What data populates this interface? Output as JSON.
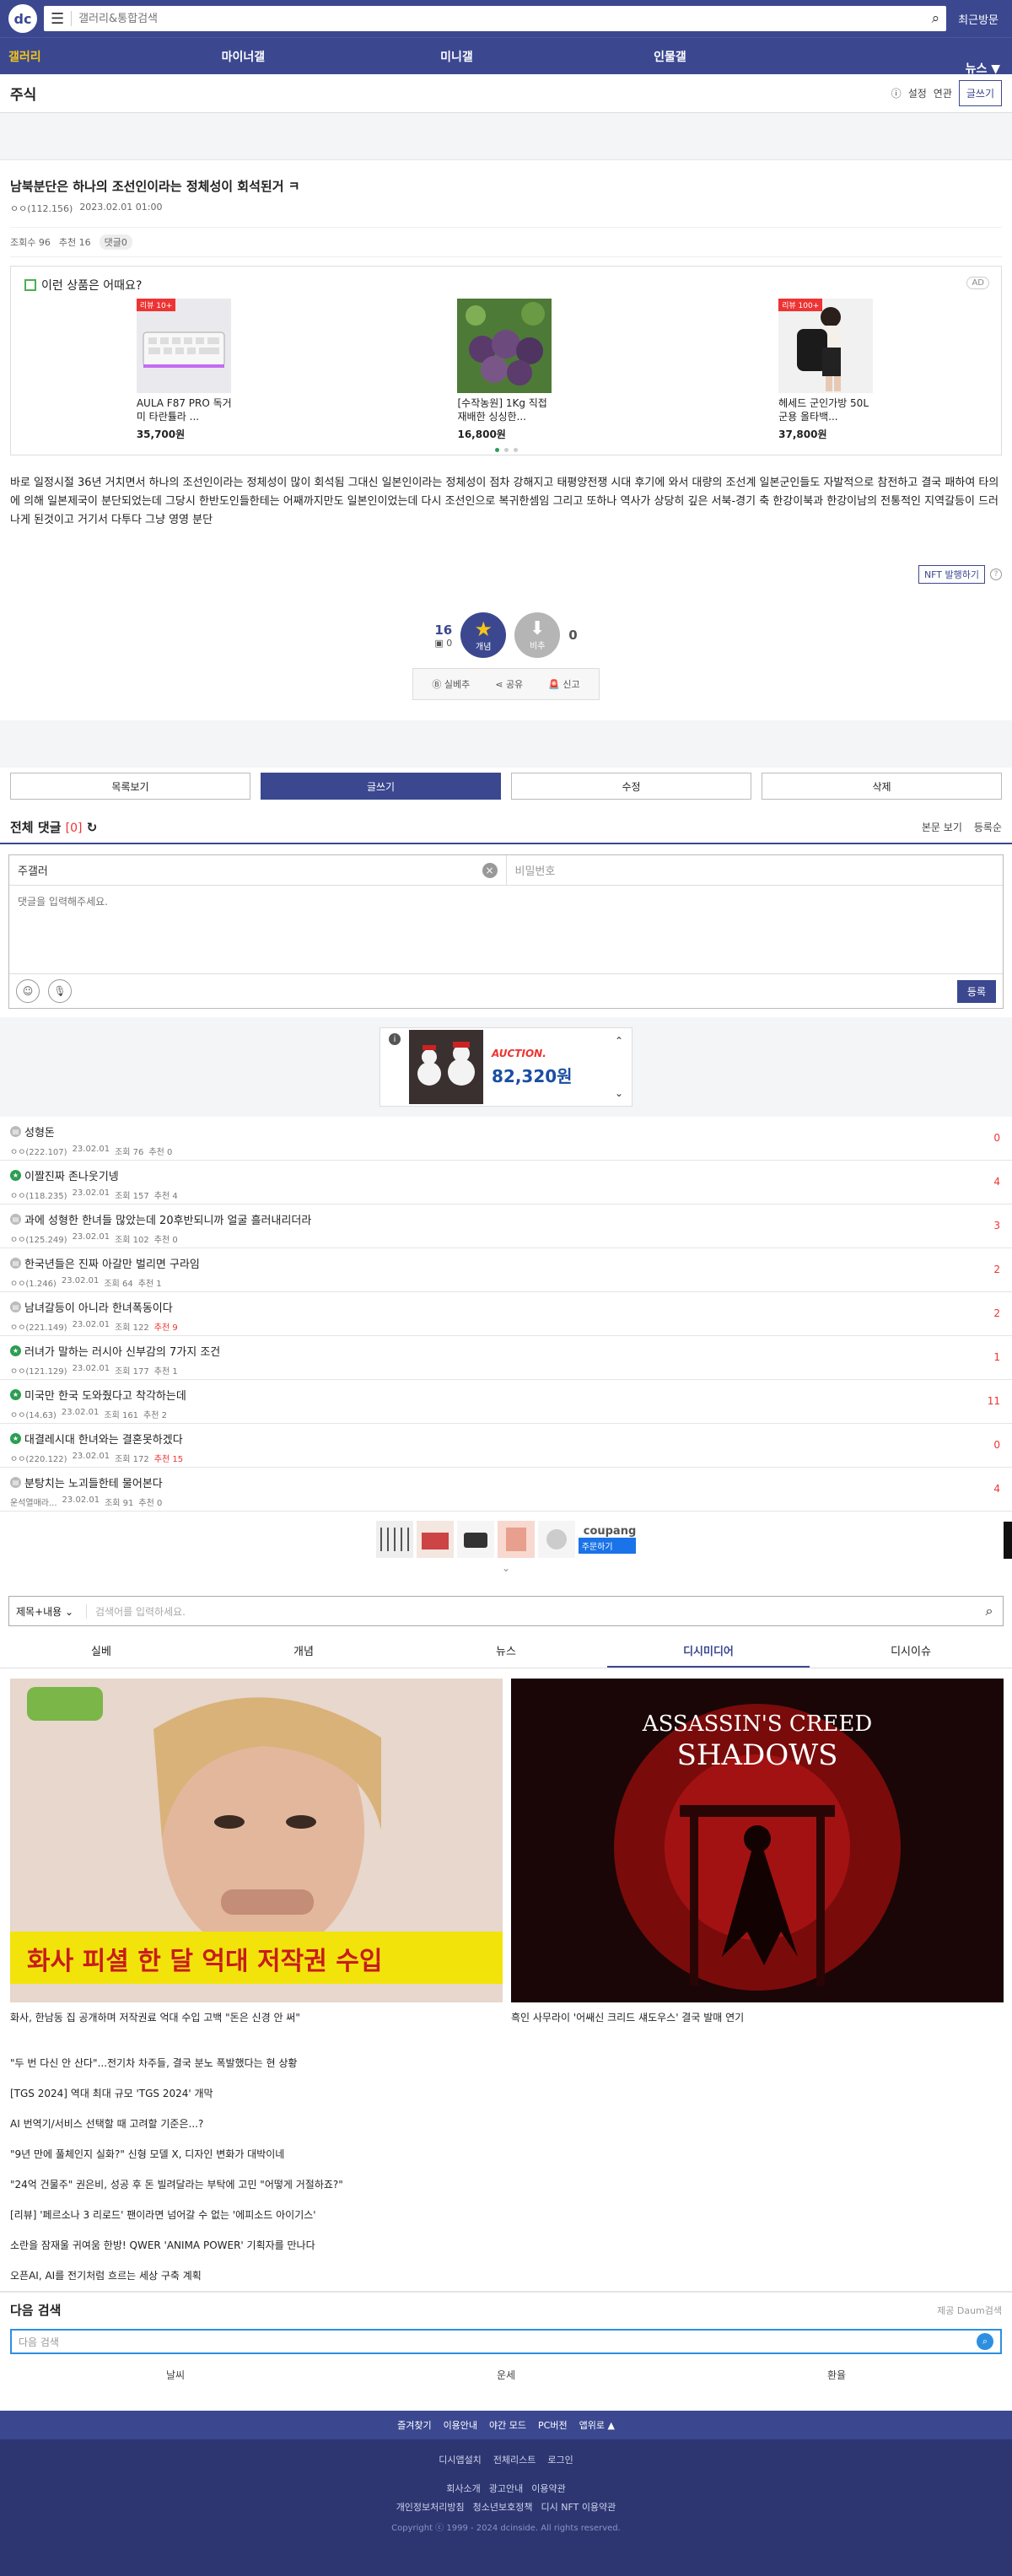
{
  "header": {
    "search_placeholder": "갤러리&통합검색",
    "recent": "최근방문"
  },
  "nav": [
    "갤러리",
    "마이너갤",
    "미니갤",
    "인물갤",
    "뉴스 ▼"
  ],
  "gallery": {
    "title": "주식",
    "setting": "설정",
    "link": "연관",
    "write": "글쓰기"
  },
  "post": {
    "title": "남북분단은 하나의 조선인이라는 정체성이 회석된거 ㅋ",
    "author": "ㅇㅇ(112.156)",
    "date": "2023.02.01 01:00",
    "views": "조회수 96",
    "recommend": "추천 16",
    "comments": "댓글0",
    "body": "바로 일정시절 36년 거치면서 하나의 조선인이라는 정체성이 많이 회석됨  그대신 일본인이라는 정체성이 점차 강해지고 태평양전쟁 시대 후기에 와서 대량의 조선계 일본군인들도 자발적으로 참전하고  결국 패하여 타의에 의해 일본제국이 분단되었는데  그당시 한반도인들한테는 어째까지만도 일본인이었는데 다시 조선인으로 복귀한셈임  그리고 또하나  역사가 상당히 깊은 서북-경기 축 한강이북과 한강이남의 전통적인 지역갈등이 드러나게 된것이고 거기서 다투다 그냥 영영 분단",
    "nft": "NFT 발행하기",
    "up_count": "16",
    "fix_count": "0",
    "up_label": "개념",
    "down_label": "비추",
    "down_count": "0",
    "share_actions": [
      "실베추",
      "공유",
      "신고"
    ]
  },
  "ad": {
    "heading": "이런 상품은 어때요?",
    "tag": "AD",
    "products": [
      {
        "tag": "리뷰 10+",
        "name": "AULA F87 PRO 독거미 타란튤라 ...",
        "price": "35,700원"
      },
      {
        "tag": "",
        "name": "[수작농원] 1Kg 직접 재배한 싱싱한...",
        "price": "16,800원"
      },
      {
        "tag": "리뷰 100+",
        "name": "헤세드 군인가방 50L 군용 올타백...",
        "price": "37,800원"
      }
    ]
  },
  "buttons": [
    "목록보기",
    "글쓰기",
    "수정",
    "삭제"
  ],
  "comments": {
    "title": "전체 댓글",
    "count": "[0]",
    "view_body": "본문 보기",
    "sort": "등록순",
    "name_value": "주갤러",
    "password_placeholder": "비밀번호",
    "content_placeholder": "댓글을 입력해주세요.",
    "submit": "등록"
  },
  "auction": {
    "brand": "AUCTION.",
    "price": "82,320원"
  },
  "list": [
    {
      "title": "성형돈",
      "green": false,
      "author": "ㅇㅇ(222.107)",
      "date": "23.02.01",
      "views": "조회 76",
      "rec": "추천 0",
      "rec_hot": false,
      "replies": "0"
    },
    {
      "title": "이짤진짜 존나웃기넹",
      "green": true,
      "author": "ㅇㅇ(118.235)",
      "date": "23.02.01",
      "views": "조회 157",
      "rec": "추천 4",
      "rec_hot": false,
      "replies": "4"
    },
    {
      "title": "과에 성형한 한녀들 많았는데 20후반되니까 얼굴 흘러내리더라",
      "green": false,
      "author": "ㅇㅇ(125.249)",
      "date": "23.02.01",
      "views": "조회 102",
      "rec": "추천 0",
      "rec_hot": false,
      "replies": "3"
    },
    {
      "title": "한국년들은 진짜 아갈만 벌리면 구라임",
      "green": false,
      "author": "ㅇㅇ(1.246)",
      "date": "23.02.01",
      "views": "조회 64",
      "rec": "추천 1",
      "rec_hot": false,
      "replies": "2"
    },
    {
      "title": "남녀갈등이 아니라 한녀폭동이다",
      "green": false,
      "author": "ㅇㅇ(221.149)",
      "date": "23.02.01",
      "views": "조회 122",
      "rec": "추천 9",
      "rec_hot": true,
      "replies": "2"
    },
    {
      "title": "러녀가 말하는 러시아 신부감의 7가지 조건",
      "green": true,
      "author": "ㅇㅇ(121.129)",
      "date": "23.02.01",
      "views": "조회 177",
      "rec": "추천 1",
      "rec_hot": false,
      "replies": "1"
    },
    {
      "title": "미국만 한국 도와줬다고 착각하는데",
      "green": true,
      "author": "ㅇㅇ(14.63)",
      "date": "23.02.01",
      "views": "조회 161",
      "rec": "추천 2",
      "rec_hot": false,
      "replies": "11"
    },
    {
      "title": "대결레시대 한녀와는 결혼못하겠다",
      "green": true,
      "author": "ㅇㅇ(220.122)",
      "date": "23.02.01",
      "views": "조회 172",
      "rec": "추천 15",
      "rec_hot": true,
      "replies": "0"
    },
    {
      "title": "분탕치는 노괴들한테 물어본다",
      "green": false,
      "author": "운석열매라...",
      "date": "23.02.01",
      "views": "조회 91",
      "rec": "추천 0",
      "rec_hot": false,
      "replies": "4"
    }
  ],
  "coupang": {
    "logo": "coupang",
    "button": "주문하기"
  },
  "search2": {
    "select": "제목+내용",
    "placeholder": "검색어를 입력하세요."
  },
  "tabs": [
    "실베",
    "개념",
    "뉴스",
    "디시미디어",
    "디시이슈"
  ],
  "media": [
    {
      "caption": "화사, 한남동 집 공개하며 저작권료 억대 수입 고백 \"돈은 신경 안 써\"",
      "overlay": "화사 피셜 한 달 억대 저작권 수입"
    },
    {
      "caption": "흑인 사무라이 '어쌔신 크리드 섀도우스' 결국 발매 연기",
      "overlay_top": "ASSASSIN'S CREED",
      "overlay_bottom": "SHADOWS"
    }
  ],
  "news": [
    "\"두 번 다신 안 산다\"...전기차 차주들, 결국 분노 폭발했다는 현 상황",
    "[TGS 2024] 역대 최대 규모 'TGS 2024' 개막",
    "AI 번역기/서비스 선택할 때 고려할 기준은...?",
    "\"9년 만에 풀체인지 실화?\" 신형 모델 X, 디자인 변화가 대박이네",
    "\"24억 건물주\" 권은비, 성공 후 돈 빌려달라는 부탁에 고민 \"어떻게 거절하죠?\"",
    "[리뷰] '페르소나 3 리로드' 팬이라면 넘어갈 수 없는 '에피소드 아이기스'",
    "소란을 잠재울 귀여움 한방! QWER 'ANIMA POWER' 기획자를 만나다",
    "오픈AI, AI를 전기처럼 흐르는 세상 구축 계획"
  ],
  "next_search": {
    "title": "다음 검색",
    "provider": "제공 Daum검색",
    "placeholder": "다음 검색",
    "keywords": [
      "날씨",
      "운세",
      "환율"
    ]
  },
  "footer": {
    "bar": [
      "즐겨찾기",
      "이용안내",
      "야간 모드",
      "PC버전",
      "앱위로 ▲"
    ],
    "row": [
      "디시앱설치",
      "전체리스트",
      "로그인"
    ],
    "row2": [
      "회사소개",
      "광고안내",
      "이용약관"
    ],
    "row3": [
      "개인정보처리방침",
      "청소년보호정책",
      "디시 NFT 이용약관"
    ],
    "copy": "Copyright ⓒ 1999 - 2024 dcinside. All rights reserved."
  }
}
